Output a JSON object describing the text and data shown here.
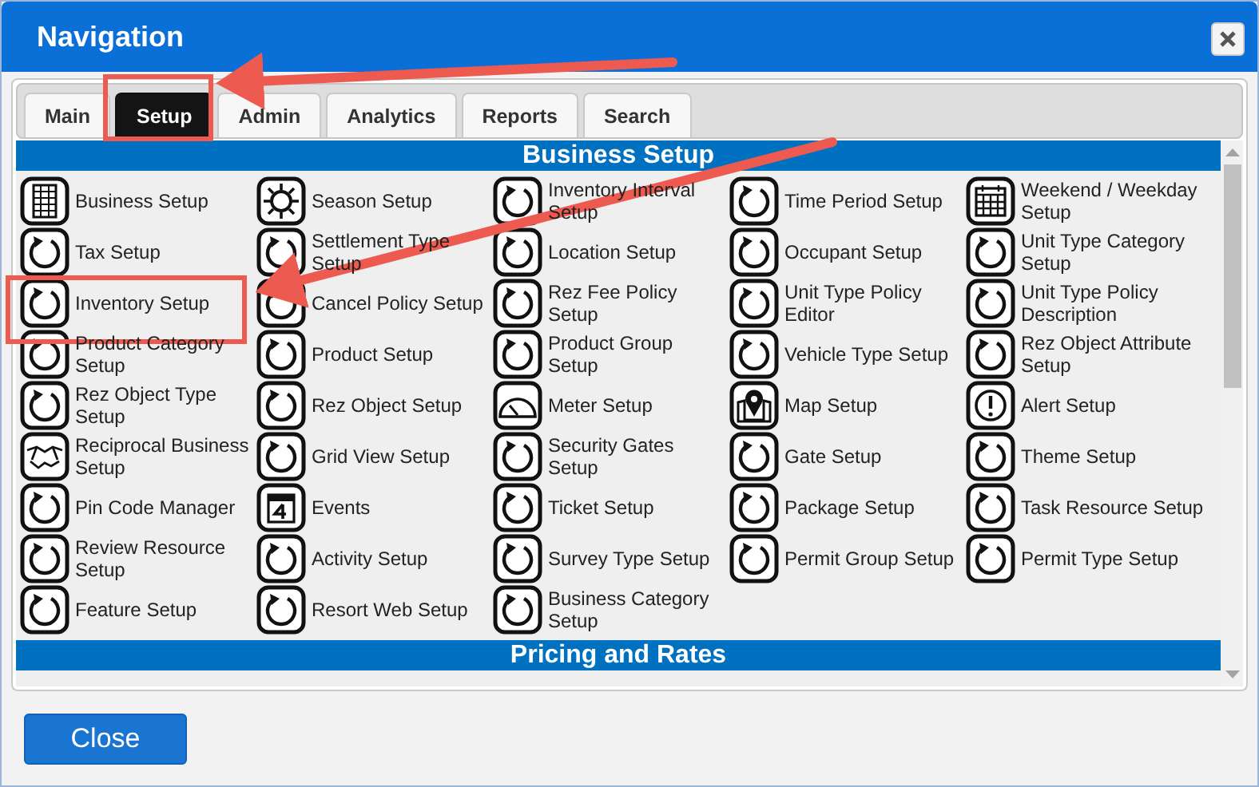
{
  "window": {
    "title": "Navigation"
  },
  "tabs": [
    {
      "label": "Main",
      "selected": false
    },
    {
      "label": "Setup",
      "selected": true
    },
    {
      "label": "Admin",
      "selected": false
    },
    {
      "label": "Analytics",
      "selected": false
    },
    {
      "label": "Reports",
      "selected": false
    },
    {
      "label": "Search",
      "selected": false
    }
  ],
  "sections": [
    {
      "title": "Business Setup",
      "items": [
        {
          "label": "Business Setup",
          "kind": "building"
        },
        {
          "label": "Season Setup",
          "kind": "sun"
        },
        {
          "label": "Inventory Interval Setup",
          "kind": "cycle"
        },
        {
          "label": "Time Period Setup",
          "kind": "cycle"
        },
        {
          "label": "Weekend / Weekday Setup",
          "kind": "calendar"
        },
        {
          "label": "Tax Setup",
          "kind": "cycle"
        },
        {
          "label": "Settlement Type Setup",
          "kind": "cycle"
        },
        {
          "label": "Location Setup",
          "kind": "cycle"
        },
        {
          "label": "Occupant Setup",
          "kind": "cycle"
        },
        {
          "label": "Unit Type Category Setup",
          "kind": "cycle"
        },
        {
          "label": "Inventory Setup",
          "kind": "cycle"
        },
        {
          "label": "Cancel Policy Setup",
          "kind": "cycle"
        },
        {
          "label": "Rez Fee Policy Setup",
          "kind": "cycle"
        },
        {
          "label": "Unit Type Policy Editor",
          "kind": "cycle"
        },
        {
          "label": "Unit Type Policy Description",
          "kind": "cycle"
        },
        {
          "label": "Product Category Setup",
          "kind": "cycle"
        },
        {
          "label": "Product Setup",
          "kind": "cycle"
        },
        {
          "label": "Product Group Setup",
          "kind": "cycle"
        },
        {
          "label": "Vehicle Type Setup",
          "kind": "cycle"
        },
        {
          "label": "Rez Object Attribute Setup",
          "kind": "cycle"
        },
        {
          "label": "Rez Object Type Setup",
          "kind": "cycle"
        },
        {
          "label": "Rez Object Setup",
          "kind": "cycle"
        },
        {
          "label": "Meter Setup",
          "kind": "gauge"
        },
        {
          "label": "Map Setup",
          "kind": "pin"
        },
        {
          "label": "Alert Setup",
          "kind": "alert"
        },
        {
          "label": "Reciprocal Business Setup",
          "kind": "handshake"
        },
        {
          "label": "Grid View Setup",
          "kind": "cycle"
        },
        {
          "label": "Security Gates Setup",
          "kind": "cycle"
        },
        {
          "label": "Gate Setup",
          "kind": "cycle"
        },
        {
          "label": "Theme Setup",
          "kind": "cycle"
        },
        {
          "label": "Pin Code Manager",
          "kind": "cycle"
        },
        {
          "label": "Events",
          "kind": "event"
        },
        {
          "label": "Ticket Setup",
          "kind": "cycle"
        },
        {
          "label": "Package Setup",
          "kind": "cycle"
        },
        {
          "label": "Task Resource Setup",
          "kind": "cycle"
        },
        {
          "label": "Review Resource Setup",
          "kind": "cycle"
        },
        {
          "label": "Activity Setup",
          "kind": "cycle"
        },
        {
          "label": "Survey Type Setup",
          "kind": "cycle"
        },
        {
          "label": "Permit Group Setup",
          "kind": "cycle"
        },
        {
          "label": "Permit Type Setup",
          "kind": "cycle"
        },
        {
          "label": "Feature Setup",
          "kind": "cycle"
        },
        {
          "label": "Resort Web Setup",
          "kind": "cycle"
        },
        {
          "label": "Business Category Setup",
          "kind": "cycle"
        }
      ]
    },
    {
      "title": "Pricing and Rates"
    }
  ],
  "close_button": {
    "label": "Close"
  }
}
